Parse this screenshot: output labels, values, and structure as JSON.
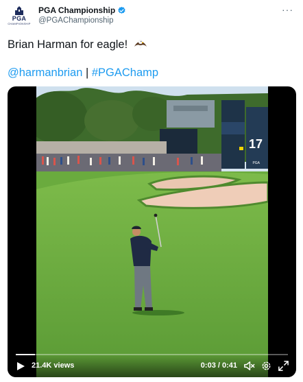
{
  "account": {
    "display_name": "PGA Championship",
    "handle": "@PGAChampionship",
    "verified_icon": "verified-badge-icon",
    "avatar_text": "PGA",
    "avatar_subtext": "CHAMPIONSHIP"
  },
  "tweet": {
    "text": "Brian Harman for eagle!",
    "emoji": "eagle-emoji",
    "mention": "@harmanbrian",
    "separator": "|",
    "hashtag": "#PGAChamp"
  },
  "video": {
    "views": "21.4K views",
    "time": "0:03 / 0:41",
    "progress": 0.07,
    "scoreboard_number": "17",
    "scoreboard_brand": "PGA",
    "controls": [
      "play-icon",
      "mute-icon",
      "settings-icon",
      "fullscreen-icon"
    ]
  },
  "colors": {
    "link": "#1d9bf0",
    "verified": "#1d9bf0",
    "secondary_text": "#536471"
  }
}
